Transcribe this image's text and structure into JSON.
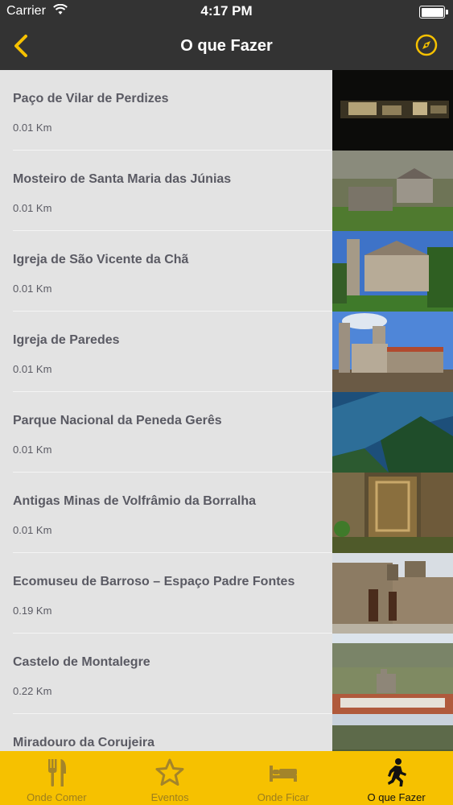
{
  "status_bar": {
    "carrier": "Carrier",
    "time": "4:17 PM"
  },
  "nav": {
    "title": "O que Fazer",
    "back_icon": "chevron-left-icon",
    "right_icon": "compass-icon"
  },
  "colors": {
    "bar": "#333333",
    "accent": "#f6c100",
    "list_bg": "#e3e3e3",
    "text": "#5a5a63"
  },
  "list": {
    "items": [
      {
        "name": "Paço de Vilar de Perdizes",
        "distance": "0.01 Km"
      },
      {
        "name": "Mosteiro de Santa Maria das Júnias",
        "distance": "0.01 Km"
      },
      {
        "name": "Igreja de São Vicente da Chã",
        "distance": "0.01 Km"
      },
      {
        "name": "Igreja de Paredes",
        "distance": "0.01 Km"
      },
      {
        "name": "Parque Nacional da Peneda Gerês",
        "distance": "0.01 Km"
      },
      {
        "name": "Antigas Minas de Volfrâmio da Borralha",
        "distance": "0.01 Km"
      },
      {
        "name": "Ecomuseu de Barroso – Espaço Padre Fontes",
        "distance": "0.19 Km"
      },
      {
        "name": "Castelo de Montalegre",
        "distance": "0.22 Km"
      },
      {
        "name": "Miradouro da Corujeira",
        "distance": ""
      }
    ]
  },
  "tabbar": {
    "tabs": [
      {
        "label": "Onde Comer",
        "icon": "fork-knife-icon",
        "active": false
      },
      {
        "label": "Eventos",
        "icon": "star-icon",
        "active": false
      },
      {
        "label": "Onde Ficar",
        "icon": "bed-icon",
        "active": false
      },
      {
        "label": "O que Fazer",
        "icon": "walking-person-icon",
        "active": true
      }
    ]
  }
}
